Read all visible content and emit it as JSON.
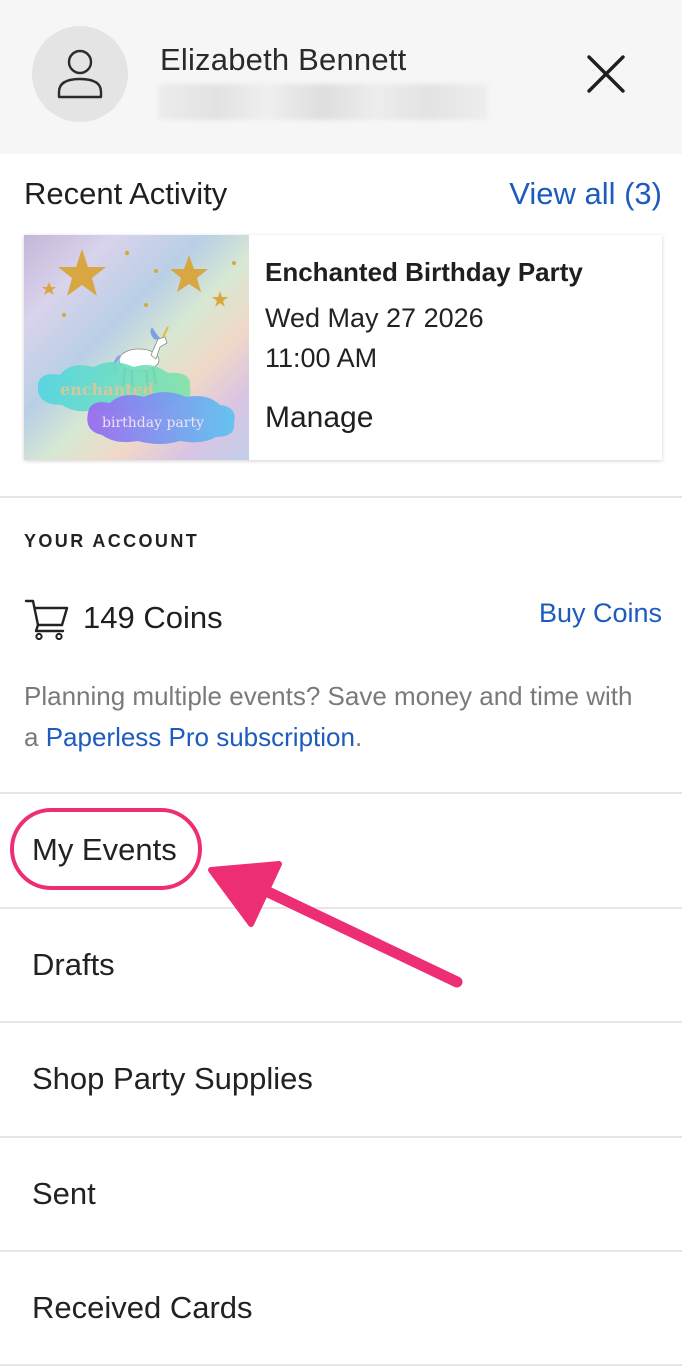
{
  "header": {
    "user_name": "Elizabeth Bennett",
    "avatar_icon": "person-icon",
    "close_icon": "close-icon"
  },
  "recent_activity": {
    "title": "Recent Activity",
    "view_all_label": "View all (3)",
    "card": {
      "thumbnail_text_line1": "enchanted",
      "thumbnail_text_line2": "birthday party",
      "event_title": "Enchanted Birthday Party",
      "date": "Wed May 27 2026",
      "time": "11:00 AM",
      "manage_label": "Manage"
    }
  },
  "account": {
    "heading": "YOUR ACCOUNT",
    "cart_icon": "cart-icon",
    "coins_label": "149 Coins",
    "buy_coins_label": "Buy Coins",
    "promo_text": "Planning multiple events? Save money and time with a ",
    "promo_link": "Paperless Pro subscription",
    "promo_end": "."
  },
  "menu": {
    "items": [
      {
        "label": "My Events"
      },
      {
        "label": "Drafts"
      },
      {
        "label": "Shop Party Supplies"
      },
      {
        "label": "Sent"
      },
      {
        "label": "Received Cards"
      }
    ]
  },
  "colors": {
    "link": "#1d5bbf",
    "highlight": "#ee2e74",
    "header_bg": "#f6f6f6"
  }
}
